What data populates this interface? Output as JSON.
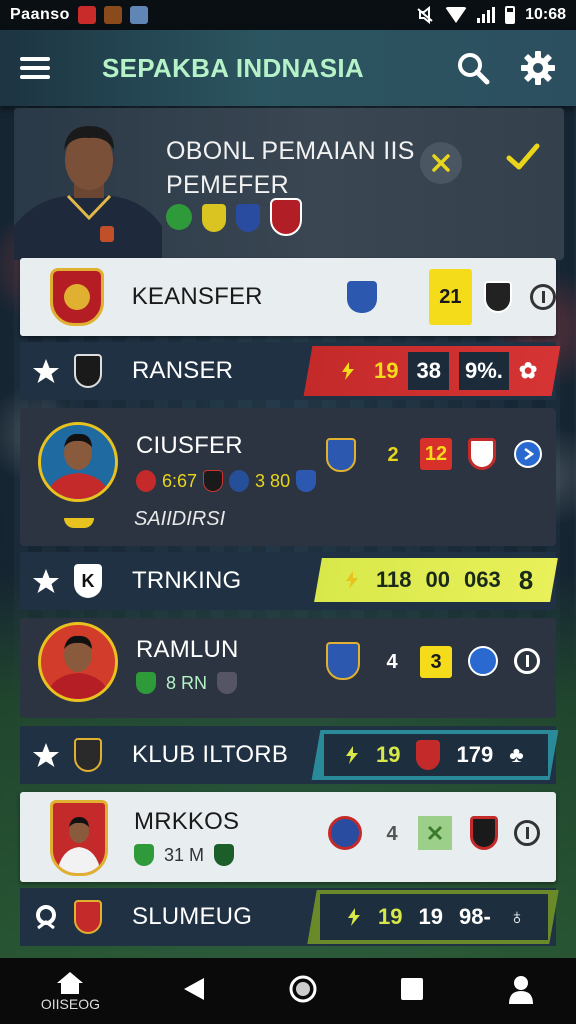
{
  "status_bar": {
    "carrier": "Paanso",
    "time": "10:68"
  },
  "app_bar": {
    "title": "SEPAKBA INDNASIA",
    "menu_icon": "hamburger-menu-icon",
    "search_icon": "search-icon",
    "settings_icon": "gear-icon"
  },
  "header": {
    "title_line1": "OBONL PEMAIAN IIS",
    "title_line2": "PEMEFER",
    "accent": "#e8d51c"
  },
  "rows": {
    "r1": {
      "name": "KEANSFER",
      "stat": "21"
    },
    "r2": {
      "name": "RANSER",
      "s1": "19",
      "s2": "38",
      "s3": "9%."
    },
    "r3": {
      "name": "CIUSFER",
      "sub_a": "6:67",
      "sub_b": "3 80",
      "tag": "SAIIDIRSI",
      "s1": "2",
      "s2": "12"
    },
    "r4": {
      "name": "TRNKING",
      "s1": "118",
      "s2": "00",
      "s3": "063",
      "s4": "8"
    },
    "r5": {
      "name": "RAMLUN",
      "sub_a": "8 RN",
      "s1": "4",
      "s2": "3"
    },
    "r6": {
      "name": "KLUB ILTORB",
      "s1": "19",
      "s2": "179"
    },
    "r7": {
      "name": "MRKKOS",
      "sub_a": "31 M",
      "s1": "4"
    },
    "r8": {
      "name": "SLUMEUG",
      "s1": "19",
      "s2": "19",
      "s3": "98-"
    }
  },
  "bottom_nav": {
    "home_label": "OIISEOG"
  }
}
